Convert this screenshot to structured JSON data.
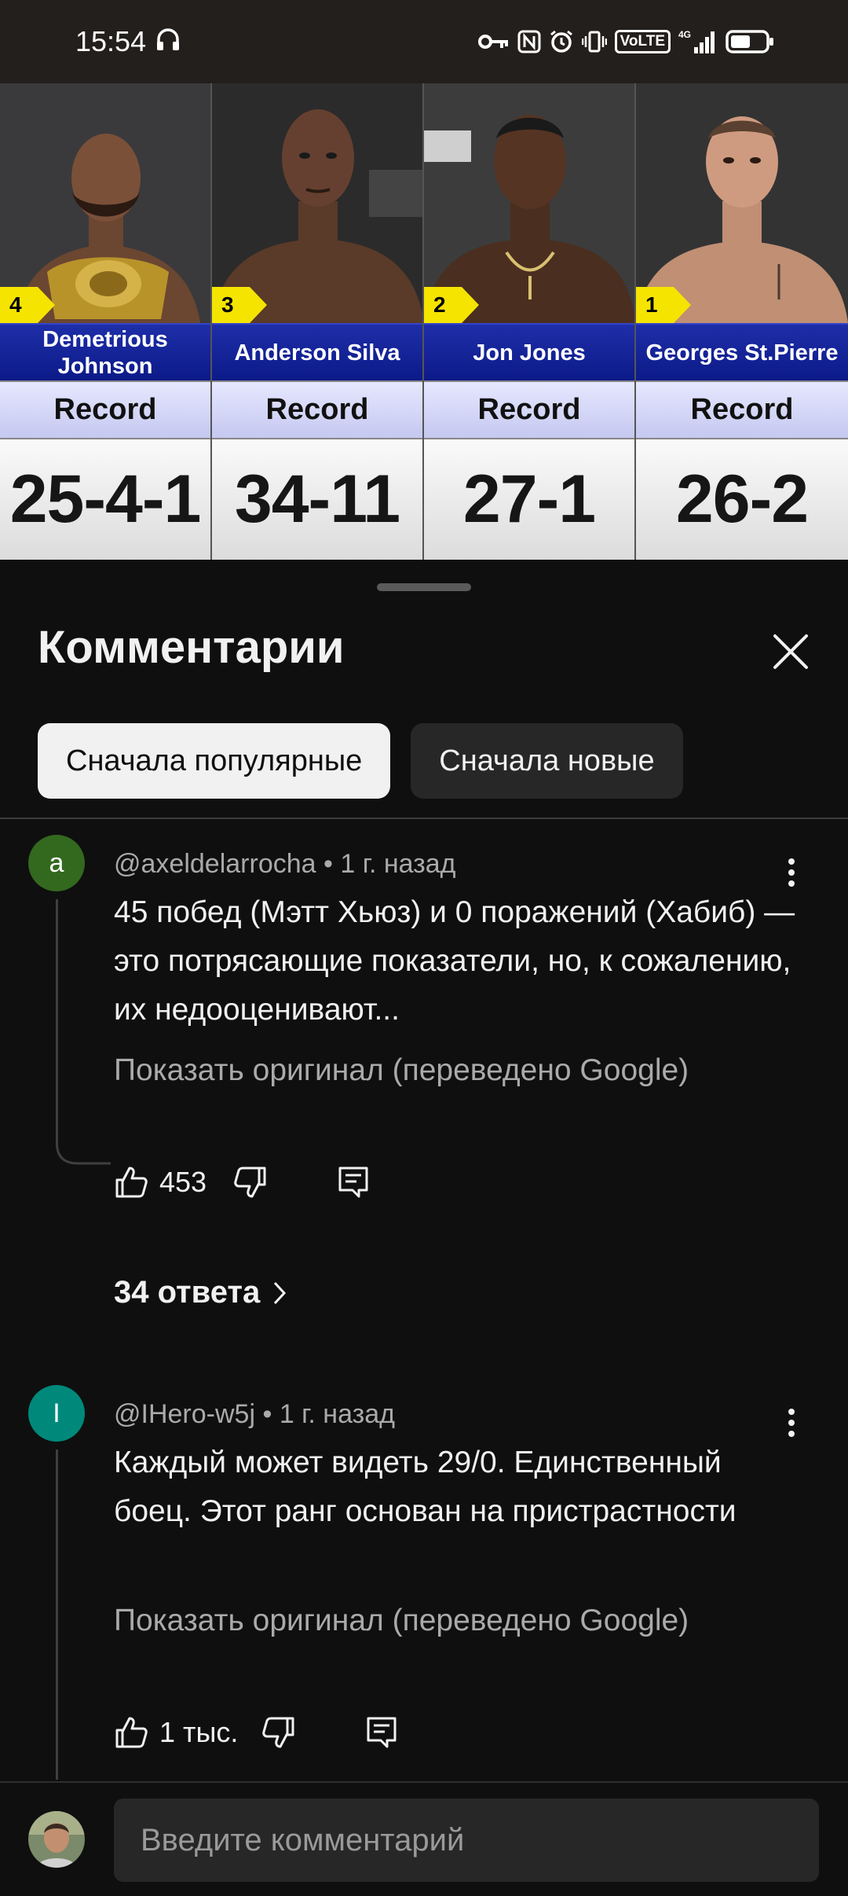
{
  "status_bar": {
    "time": "15:54",
    "icons": [
      "headphones-icon",
      "key-icon",
      "nfc-icon",
      "alarm-icon",
      "vibrate-icon",
      "volte-icon",
      "signal-4g-icon",
      "battery-icon"
    ],
    "volte_label": "VoLTE",
    "network_label": "4G"
  },
  "video": {
    "fighters": [
      {
        "rank": "4",
        "name": "Demetrious Johnson",
        "record_label": "Record",
        "record": "25-4-1"
      },
      {
        "rank": "3",
        "name": "Anderson Silva",
        "record_label": "Record",
        "record": "34-11"
      },
      {
        "rank": "2",
        "name": "Jon Jones",
        "record_label": "Record",
        "record": "27-1"
      },
      {
        "rank": "1",
        "name": "Georges St.Pierre",
        "record_label": "Record",
        "record": "26-2"
      }
    ]
  },
  "sheet": {
    "title": "Комментарии",
    "close_icon": "close-icon",
    "sort_chips": [
      "Сначала популярные",
      "Сначала новые"
    ],
    "active_chip": "Сначала популярные"
  },
  "comments": [
    {
      "avatar_letter": "a",
      "avatar_color": "#33691e",
      "author": "@axeldelarrocha",
      "time": "1 г. назад",
      "text": "45 побед (Мэтт Хьюз) и 0 поражений (Хабиб) — это потрясающие показатели, но, к сожалению, их недооценивают...",
      "translate_label": "Показать оригинал (переведено Google)",
      "likes": "453",
      "replies_label": "34 ответа"
    },
    {
      "avatar_letter": "I",
      "avatar_color": "#00897b",
      "author": "@IHero-w5j",
      "time": "1 г. назад",
      "text": "Каждый может видеть 29/0. Единственный боец.   Этот ранг основан на пристрастности",
      "translate_label": "Показать оригинал (переведено Google)",
      "likes": "1 тыс."
    }
  ],
  "comment_input": {
    "placeholder": "Введите комментарий"
  }
}
